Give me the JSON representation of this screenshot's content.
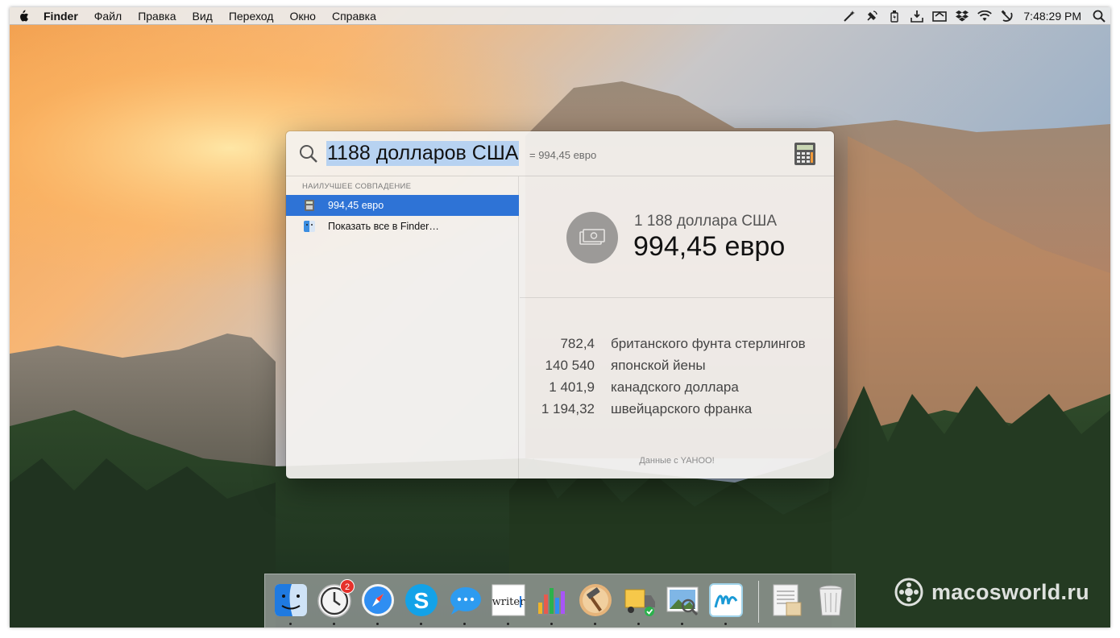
{
  "menubar": {
    "apple_icon": "apple-logo-icon",
    "app_name": "Finder",
    "menus": [
      "Файл",
      "Правка",
      "Вид",
      "Переход",
      "Окно",
      "Справка"
    ],
    "status_icons": [
      "magic-wand-icon",
      "satellite-icon",
      "battery-plug-icon",
      "download-tray-icon",
      "tray-icon",
      "dropbox-icon",
      "wifi-icon",
      "hammer-sickle-icon"
    ],
    "clock": "7:48:29 PM",
    "spotlight_icon": "search-icon"
  },
  "spotlight": {
    "query": "1188 долларов США",
    "hint": "= 994,45 евро",
    "section_title": "НАИЛУЧШЕЕ СОВПАДЕНИЕ",
    "results": [
      {
        "label": "994,45 евро",
        "icon": "calculator-icon",
        "selected": true
      },
      {
        "label": "Показать все в Finder…",
        "icon": "finder-icon",
        "selected": false
      }
    ],
    "preview": {
      "source_amount": "1 188 доллара США",
      "result_amount": "994,45 евро",
      "rates": [
        {
          "amount": "782,4",
          "currency": "британского фунта стерлингов"
        },
        {
          "amount": "140 540",
          "currency": "японской йены"
        },
        {
          "amount": "1 401,9",
          "currency": "канадского доллара"
        },
        {
          "amount": "1 194,32",
          "currency": "швейцарского франка"
        }
      ],
      "data_source": "Данные с YAHOO!"
    }
  },
  "dock": {
    "apps": [
      {
        "name": "Finder",
        "icon": "finder-icon",
        "running": true
      },
      {
        "name": "Time Tracker",
        "icon": "clock-icon",
        "running": true,
        "badge": "2"
      },
      {
        "name": "Safari",
        "icon": "safari-compass-icon",
        "running": true
      },
      {
        "name": "Skype",
        "icon": "skype-icon",
        "running": true
      },
      {
        "name": "Messages",
        "icon": "messages-bubble-icon",
        "running": true
      },
      {
        "name": "Writer",
        "icon": "writer-icon",
        "running": true
      },
      {
        "name": "Numbers",
        "icon": "bar-chart-icon",
        "running": true
      },
      {
        "name": "Tools",
        "icon": "hammer-icon",
        "running": true
      },
      {
        "name": "Transmit",
        "icon": "delivery-truck-icon",
        "running": true
      },
      {
        "name": "Preview",
        "icon": "photo-preview-icon",
        "running": true
      },
      {
        "name": "Scribble",
        "icon": "drawing-icon",
        "running": true
      },
      {
        "name": "Documents",
        "icon": "documents-stack-icon",
        "running": false
      },
      {
        "name": "Trash",
        "icon": "trash-icon",
        "running": false
      }
    ]
  },
  "watermark": "macosworld.ru"
}
